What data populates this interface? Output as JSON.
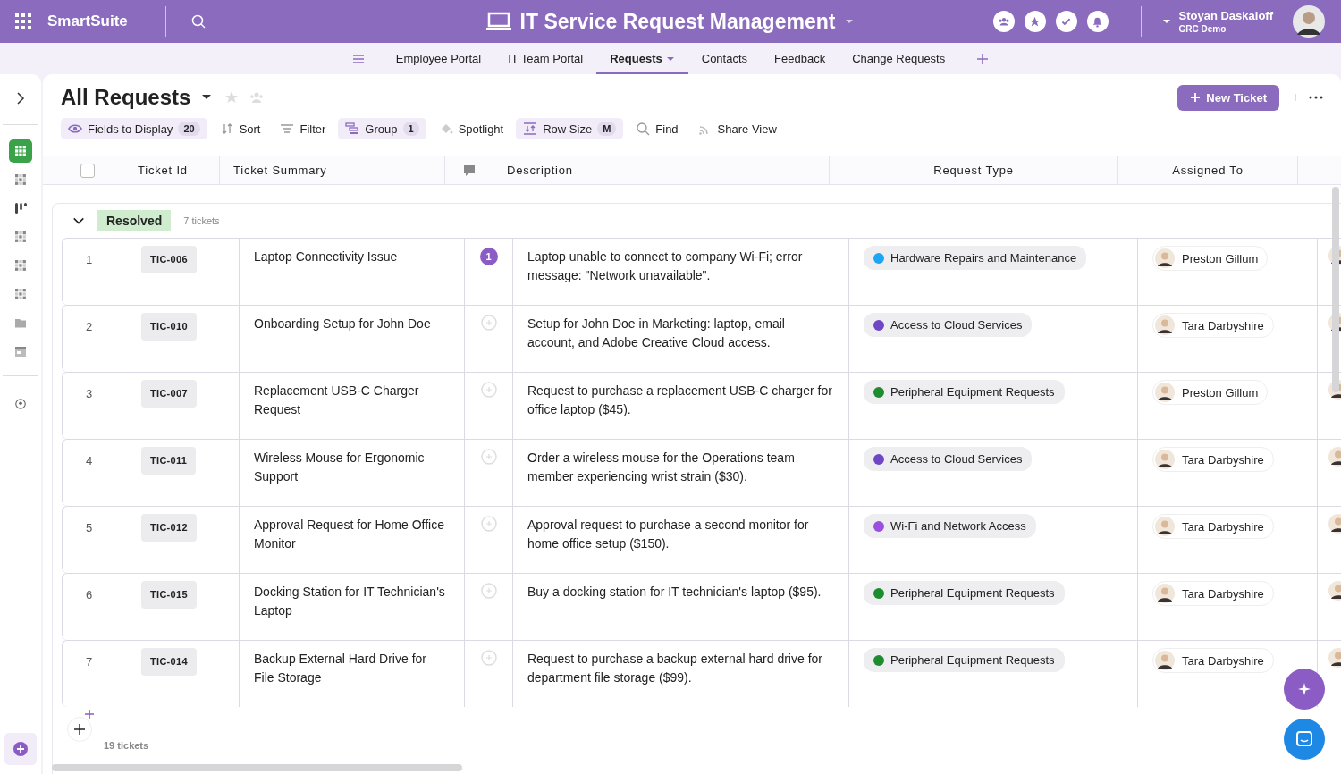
{
  "app": {
    "name": "SmartSuite"
  },
  "header": {
    "title": "IT Service Request Management",
    "user_name": "Stoyan Daskaloff",
    "user_org": "GRC Demo"
  },
  "nav_tabs": [
    {
      "label": "Employee Portal",
      "selected": false
    },
    {
      "label": "IT Team Portal",
      "selected": false
    },
    {
      "label": "Requests",
      "selected": true
    },
    {
      "label": "Contacts",
      "selected": false
    },
    {
      "label": "Feedback",
      "selected": false
    },
    {
      "label": "Change Requests",
      "selected": false
    }
  ],
  "sidebar": {
    "items": [
      {
        "kind": "grid",
        "selected": true
      },
      {
        "kind": "dots",
        "selected": false
      },
      {
        "kind": "kanban",
        "selected": false
      },
      {
        "kind": "dots",
        "selected": false
      },
      {
        "kind": "dots",
        "selected": false
      },
      {
        "kind": "dots",
        "selected": false
      },
      {
        "kind": "folder",
        "selected": false
      },
      {
        "kind": "calendar",
        "selected": false
      }
    ]
  },
  "view": {
    "title": "All Requests",
    "new_button": "New Ticket"
  },
  "toolbar": [
    {
      "kind": "fields",
      "label": "Fields to Display",
      "count": "20",
      "active": true
    },
    {
      "kind": "sort",
      "label": "Sort",
      "active": false
    },
    {
      "kind": "filter",
      "label": "Filter",
      "active": false
    },
    {
      "kind": "group",
      "label": "Group",
      "count": "1",
      "active": true
    },
    {
      "kind": "spotlight",
      "label": "Spotlight",
      "active": false
    },
    {
      "kind": "rowsize",
      "label": "Row Size",
      "count": "M",
      "active": true
    },
    {
      "kind": "find",
      "label": "Find",
      "active": false
    },
    {
      "kind": "share",
      "label": "Share View",
      "active": false
    }
  ],
  "table": {
    "select_all": {
      "checked": false
    },
    "columns": [
      "Ticket Id",
      "Ticket Summary",
      "Description",
      "Request Type",
      "Assigned To"
    ],
    "group": {
      "label": "Resolved",
      "count": "7 tickets"
    },
    "rows": [
      {
        "number": "1",
        "ticket_id": "TIC-006",
        "summary": "Laptop Connectivity Issue",
        "comments": "1",
        "description": "Laptop unable to connect to company Wi-Fi; error message: \"Network unavailable\".",
        "request_type": {
          "label": "Hardware Repairs and Maintenance",
          "color": "#1aa6f5"
        },
        "assigned_to": "Preston Gillum"
      },
      {
        "number": "2",
        "ticket_id": "TIC-010",
        "summary": "Onboarding Setup for John Doe",
        "description": "Setup for John Doe in Marketing: laptop, email account, and Adobe Creative Cloud access.",
        "request_type": {
          "label": "Access to Cloud Services",
          "color": "#6f47c4"
        },
        "assigned_to": "Tara Darbyshire"
      },
      {
        "number": "3",
        "ticket_id": "TIC-007",
        "summary": "Replacement USB-C Charger Request",
        "description": "Request to purchase a replacement USB-C charger for office laptop ($45).",
        "request_type": {
          "label": "Peripheral Equipment Requests",
          "color": "#1c8c2e"
        },
        "assigned_to": "Preston Gillum"
      },
      {
        "number": "4",
        "ticket_id": "TIC-011",
        "summary": "Wireless Mouse for Ergonomic Support",
        "description": "Order a wireless mouse for the Operations team member experiencing wrist strain ($30).",
        "request_type": {
          "label": "Access to Cloud Services",
          "color": "#6f47c4"
        },
        "assigned_to": "Tara Darbyshire"
      },
      {
        "number": "5",
        "ticket_id": "TIC-012",
        "summary": "Approval Request for Home Office Monitor",
        "description": "Approval request to purchase a second monitor for home office setup ($150).",
        "request_type": {
          "label": "Wi-Fi and Network Access",
          "color": "#9a4fe0"
        },
        "assigned_to": "Tara Darbyshire"
      },
      {
        "number": "6",
        "ticket_id": "TIC-015",
        "summary": "Docking Station for IT Technician's Laptop",
        "description": "Buy a docking station for IT technician's laptop ($95).",
        "request_type": {
          "label": "Peripheral Equipment Requests",
          "color": "#1c8c2e"
        },
        "assigned_to": "Tara Darbyshire"
      },
      {
        "number": "7",
        "ticket_id": "TIC-014",
        "summary": "Backup External Hard Drive for File Storage",
        "description": "Request to purchase a backup external hard drive for department file storage ($99).",
        "request_type": {
          "label": "Peripheral Equipment Requests",
          "color": "#1c8c2e"
        },
        "assigned_to": "Tara Darbyshire"
      }
    ],
    "footer_count": "19 tickets"
  }
}
